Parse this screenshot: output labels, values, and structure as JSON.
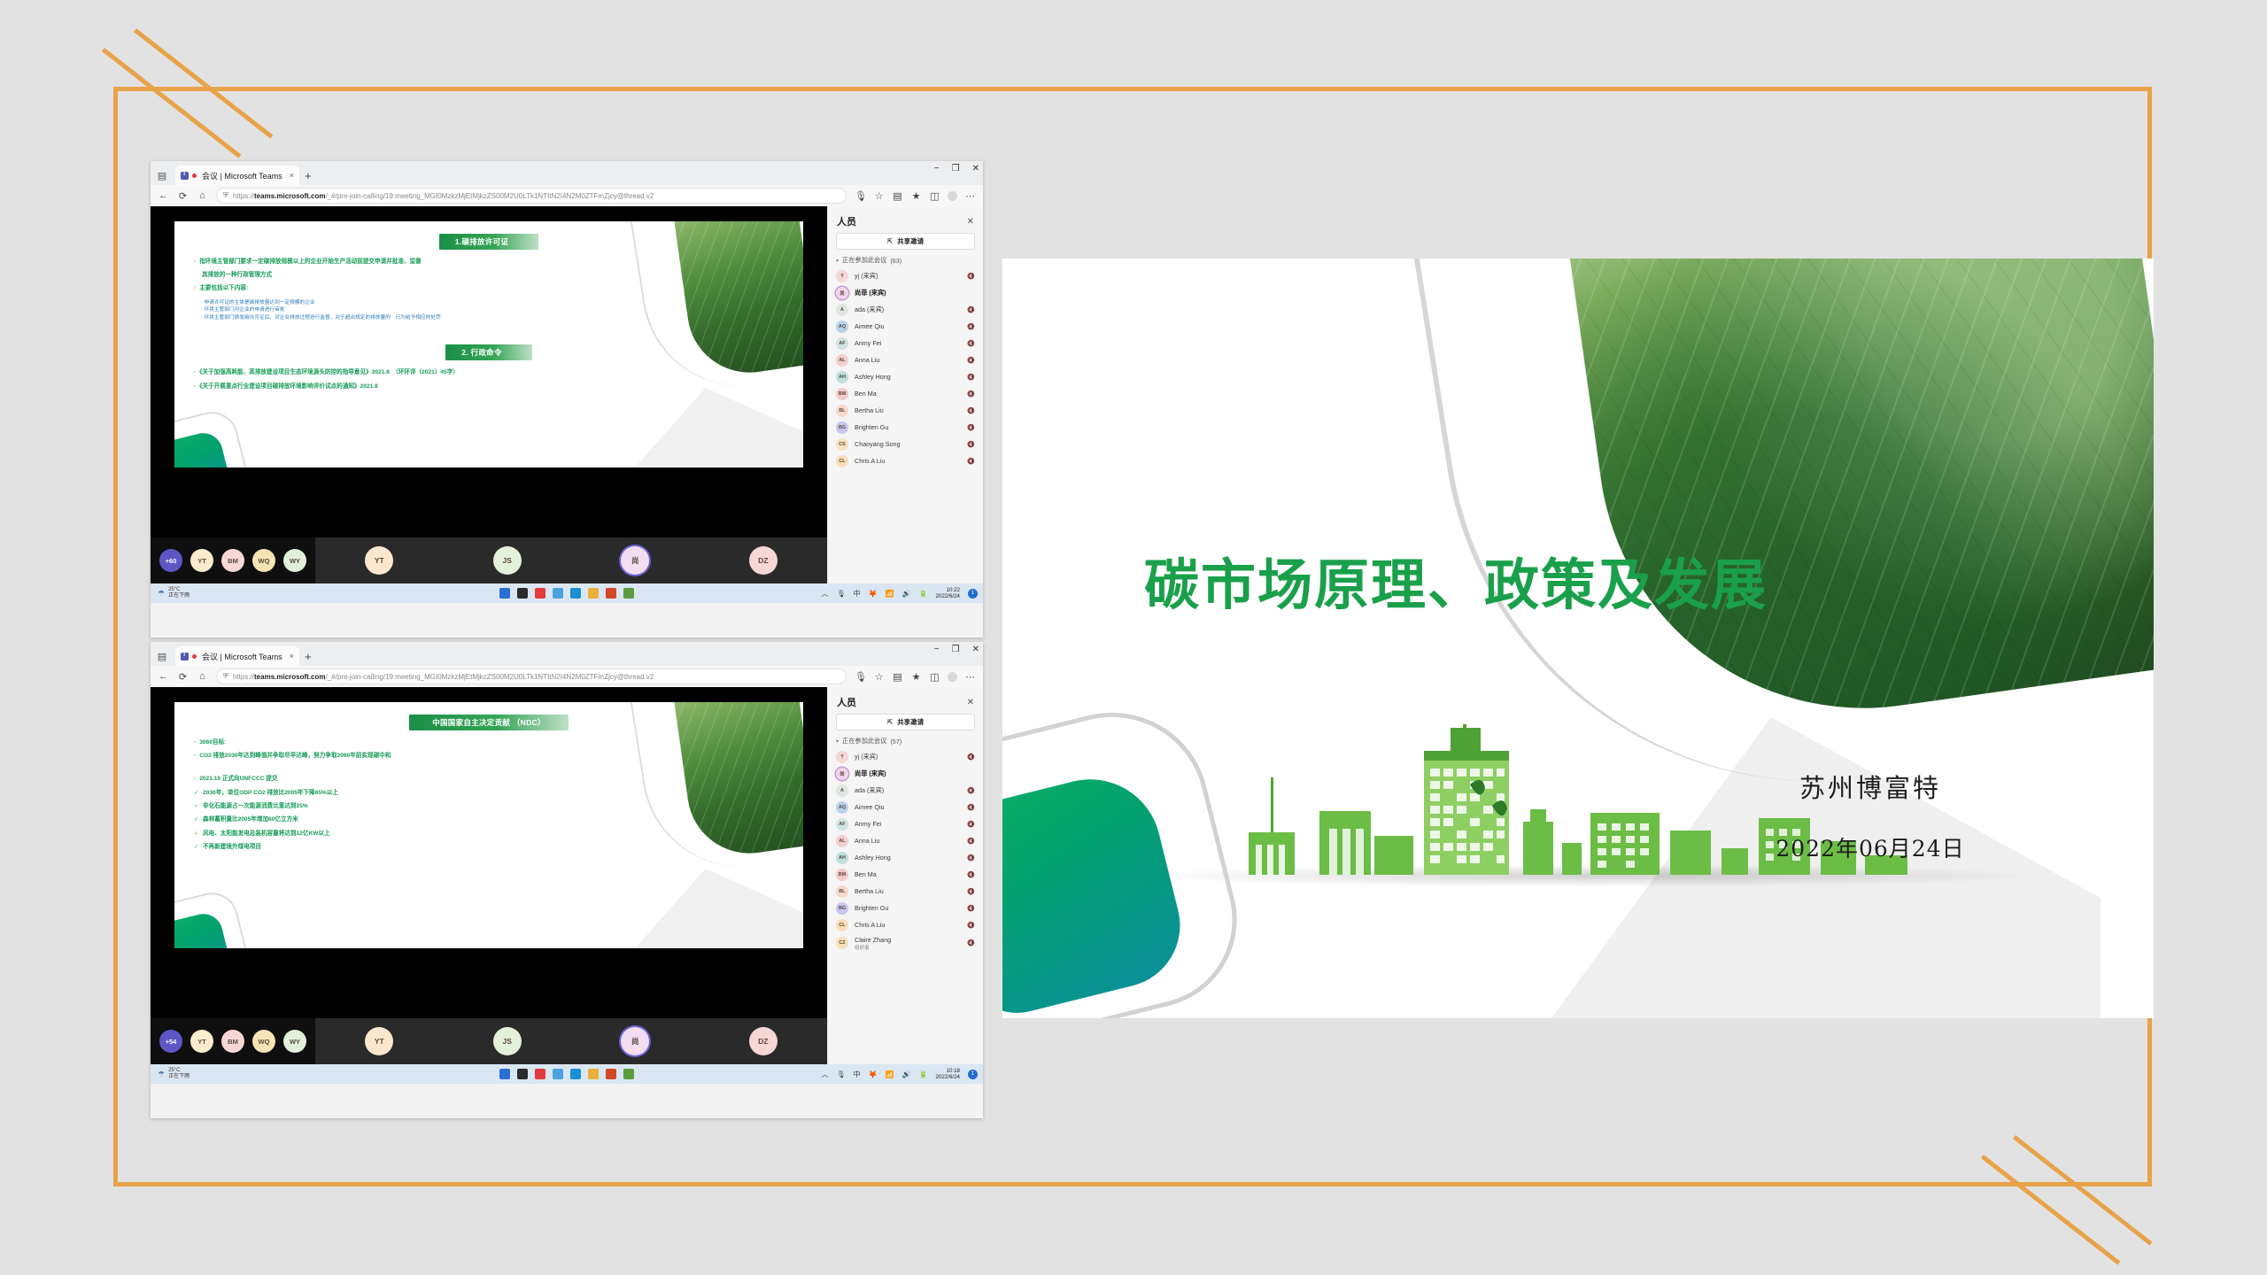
{
  "theme": {
    "accent_orange": "#e8a349",
    "slide_green": "#1aa04a",
    "band_green": "#1a8f46",
    "teal": "#0b8f9b"
  },
  "ppt_slide": {
    "title": "碳市场原理、政策及发展",
    "organization": "苏州博富特",
    "date": "2022年06月24日"
  },
  "browsers": [
    {
      "id": "browser-1",
      "tab": {
        "title": "会议 | Microsoft Teams",
        "close_label": "×",
        "new_tab_label": "+"
      },
      "window_controls": {
        "minimize": "−",
        "maximize": "❐",
        "close": "✕"
      },
      "toolbar": {
        "back_icon": "←",
        "reload_icon": "⟳",
        "home_icon": "⌂",
        "url": "https://teams.microsoft.com/_#/pre-join-calling/19:meeting_MGI0MzkzMjEtMjkzZS00M2U0LTk1NTItN2I4N2M0ZTFmZjcy@thread.v2",
        "url_bold": "teams.microsoft.com",
        "lock_icon": "🔒",
        "right_icons": [
          "mic-icon",
          "star-icon",
          "collections-icon",
          "favorites-icon",
          "split-icon",
          "profile-icon",
          "more-icon"
        ]
      },
      "slide": {
        "sections": [
          {
            "band": "1.碳排放许可证",
            "level1": [
              "指环境主管部门要求一定碳排放规模以上的企业开始生产活动前提交申请并批准、监督",
              "其排放的一种行政管理方式",
              "主要包括以下内容:"
            ],
            "level2": [
              "- 申请许可证的主体是碳排放量达到一定规模的企业",
              "- 环境主管部门对企业的申请进行审批",
              "- 环境主管部门颁发碳许可证后，对企业排放过程进行监督，对于超出规定的排放量的　行为给予相应的处罚"
            ]
          },
          {
            "band": "2. 行政命令",
            "level1": [
              "《关于加强高耗能、高排放建设项目生态环境源头防控的指导意见》2021.6　（环环评（2021）45字）",
              "《关于开展重点行业建设项目碳排放环境影响评价试点的通知》2021.8"
            ],
            "level2": []
          }
        ]
      },
      "tray": {
        "overflow": "+60",
        "small_avatars": [
          "YT",
          "BM",
          "WQ",
          "WY"
        ],
        "big_avatars": [
          "YT",
          "JS",
          "尚",
          "DZ"
        ]
      },
      "people": {
        "title": "人员",
        "close_label": "✕",
        "share_label": "共享邀请",
        "share_icon": "share-icon",
        "section_label": "正在参加此会议",
        "section_count": "(63)",
        "participants": [
          {
            "initials": "Y",
            "name": "yj (来宾)",
            "color": "#f6d7d7",
            "muted": true,
            "bold": false
          },
          {
            "initials": "尚",
            "name": "尚菲 (来宾)",
            "color": "#f2d6ee",
            "muted": false,
            "bold": true,
            "ring": true
          },
          {
            "initials": "A",
            "name": "ada (来宾)",
            "color": "#dfe6e2",
            "muted": true,
            "bold": false
          },
          {
            "initials": "AQ",
            "name": "Aimee Qiu",
            "color": "#b9d2ea",
            "muted": true,
            "bold": false
          },
          {
            "initials": "AF",
            "name": "Anmy Fei",
            "color": "#cfe4e2",
            "muted": true,
            "bold": false
          },
          {
            "initials": "AL",
            "name": "Anna Liu",
            "color": "#f4cfcf",
            "muted": true,
            "bold": false
          },
          {
            "initials": "AH",
            "name": "Ashley Hong",
            "color": "#bfe0dd",
            "muted": true,
            "bold": false
          },
          {
            "initials": "BM",
            "name": "Ben Ma",
            "color": "#f5c9c9",
            "muted": true,
            "bold": false
          },
          {
            "initials": "BL",
            "name": "Bertha Liu",
            "color": "#f7d8cb",
            "muted": true,
            "bold": false
          },
          {
            "initials": "BG",
            "name": "Brighten Gu",
            "color": "#c9c6ef",
            "muted": true,
            "bold": false
          },
          {
            "initials": "CS",
            "name": "Chaoyang Song",
            "color": "#f6e3bf",
            "muted": true,
            "bold": false
          },
          {
            "initials": "CL",
            "name": "Chris A Liu",
            "color": "#f7e0b8",
            "muted": true,
            "bold": false
          }
        ]
      },
      "taskbar": {
        "weather_temp": "25°C",
        "weather_desc": "正在下雨",
        "weather_icon": "rain-icon",
        "apps": [
          "start-icon",
          "taskview-icon",
          "recorder-icon",
          "search-icon",
          "edge-icon",
          "explorer-icon",
          "powerpoint-icon",
          "teams-icon"
        ],
        "sys_icons": [
          "chevron-up-icon",
          "mic-icon",
          "ime-icon",
          "sogou-icon",
          "wifi-icon",
          "volume-icon",
          "battery-icon"
        ],
        "time": "10:22",
        "date": "2022/6/24"
      }
    },
    {
      "id": "browser-2",
      "tab": {
        "title": "会议 | Microsoft Teams",
        "close_label": "×",
        "new_tab_label": "+"
      },
      "window_controls": {
        "minimize": "−",
        "maximize": "❐",
        "close": "✕"
      },
      "toolbar": {
        "back_icon": "←",
        "reload_icon": "⟳",
        "home_icon": "⌂",
        "url": "https://teams.microsoft.com/_#/pre-join-calling/19:meeting_MGI0MzkzMjEtMjkzZS00M2U0LTk1NTItN2I4N2M0ZTFmZjcy@thread.v2",
        "url_bold": "teams.microsoft.com",
        "lock_icon": "🔒",
        "right_icons": [
          "mic-icon",
          "star-icon",
          "collections-icon",
          "favorites-icon",
          "split-icon",
          "profile-icon",
          "more-icon"
        ]
      },
      "slide": {
        "sections": [
          {
            "band": "中国国家自主决定贡献 （NDC）",
            "level1": [
              "3060目标:",
              "CO2 排放2030年达到峰值并争取尽早达峰，努力争取2060年前实现碳中和"
            ],
            "level2": []
          }
        ],
        "list": [
          {
            "marker": "dot",
            "text": "2021.10 正式向UNFCCC 提交"
          },
          {
            "marker": "check",
            "text": "2030年，单位GDP CO2 排放比2005年下降65%以上"
          },
          {
            "marker": "check",
            "text": "非化石能源占一次能源消费比重达到25%"
          },
          {
            "marker": "check",
            "text": "森林蓄积量比2005年增加60亿立方米"
          },
          {
            "marker": "check",
            "text": "风电、太阳能发电总装机容量将达到12亿KW以上"
          },
          {
            "marker": "check",
            "text": "不再新建境外煤电项目"
          }
        ]
      },
      "tray": {
        "overflow": "+54",
        "small_avatars": [
          "YT",
          "BM",
          "WQ",
          "WY"
        ],
        "big_avatars": [
          "YT",
          "JS",
          "尚",
          "DZ"
        ]
      },
      "people": {
        "title": "人员",
        "close_label": "✕",
        "share_label": "共享邀请",
        "share_icon": "share-icon",
        "section_label": "正在参加此会议",
        "section_count": "(57)",
        "participants": [
          {
            "initials": "Y",
            "name": "yj (来宾)",
            "color": "#f6d7d7",
            "muted": true,
            "bold": false
          },
          {
            "initials": "尚",
            "name": "尚菲 (来宾)",
            "color": "#f2d6ee",
            "muted": false,
            "bold": true,
            "ring": true
          },
          {
            "initials": "A",
            "name": "ada (来宾)",
            "color": "#dfe6e2",
            "muted": true,
            "bold": false
          },
          {
            "initials": "AQ",
            "name": "Aimee Qiu",
            "color": "#b9d2ea",
            "muted": true,
            "bold": false
          },
          {
            "initials": "AF",
            "name": "Anmy Fei",
            "color": "#cfe4e2",
            "muted": true,
            "bold": false
          },
          {
            "initials": "AL",
            "name": "Anna Liu",
            "color": "#f4cfcf",
            "muted": true,
            "bold": false
          },
          {
            "initials": "AH",
            "name": "Ashley Hong",
            "color": "#bfe0dd",
            "muted": true,
            "bold": false
          },
          {
            "initials": "BM",
            "name": "Ben Ma",
            "color": "#f5c9c9",
            "muted": true,
            "bold": false
          },
          {
            "initials": "BL",
            "name": "Bertha Liu",
            "color": "#f7d8cb",
            "muted": true,
            "bold": false
          },
          {
            "initials": "BG",
            "name": "Brighten Gu",
            "color": "#c9c6ef",
            "muted": true,
            "bold": false
          },
          {
            "initials": "CL",
            "name": "Chris A Liu",
            "color": "#f7e0b8",
            "muted": true,
            "bold": false
          },
          {
            "initials": "CZ",
            "name": "Claire Zhang",
            "sub": "组织者",
            "color": "#f7e0b8",
            "muted": true,
            "bold": false
          }
        ]
      },
      "taskbar": {
        "weather_temp": "25°C",
        "weather_desc": "正在下雨",
        "weather_icon": "rain-icon",
        "apps": [
          "start-icon",
          "taskview-icon",
          "recorder-icon",
          "search-icon",
          "edge-icon",
          "explorer-icon",
          "powerpoint-icon",
          "teams-icon"
        ],
        "sys_icons": [
          "chevron-up-icon",
          "mic-icon",
          "ime-icon",
          "sogou-icon",
          "wifi-icon",
          "volume-icon",
          "battery-icon"
        ],
        "time": "10:18",
        "date": "2022/6/24"
      }
    }
  ]
}
